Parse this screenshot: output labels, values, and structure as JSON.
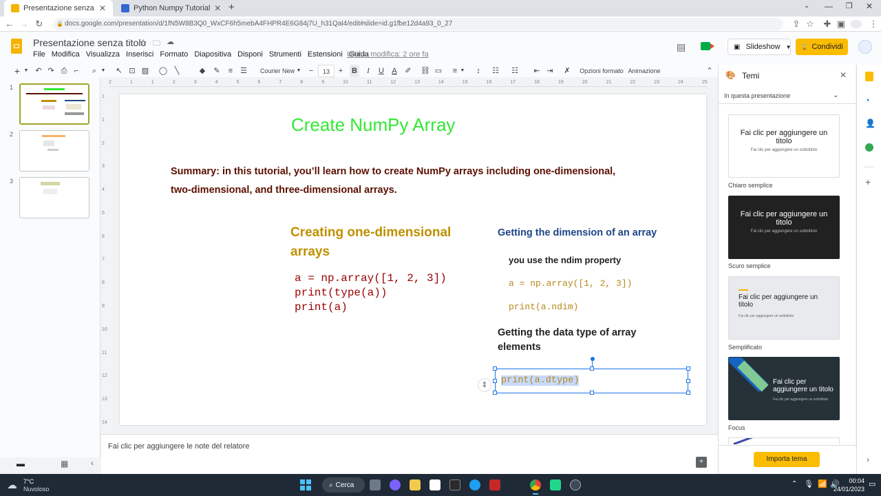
{
  "browser": {
    "tabs": [
      {
        "title": "Presentazione senza titolo - Pres",
        "favicon_color": "#f4b400",
        "active": true
      },
      {
        "title": "Python Numpy Tutorial",
        "favicon_color": "#3367d6",
        "active": false
      }
    ],
    "new_tab": "+",
    "url": "docs.google.com/presentation/d/1fN5W8B3Q0_WxCF6h5mebA4FHPR4E6G84j7U_h31Qal4/edit#slide=id.g1fbe12d4a93_0_27"
  },
  "docs": {
    "title": "Presentazione senza titolo",
    "menu": [
      "File",
      "Modifica",
      "Visualizza",
      "Inserisci",
      "Formato",
      "Diapositiva",
      "Disponi",
      "Strumenti",
      "Estensioni",
      "Guida"
    ],
    "last_edit": "Ultima modifica: 2 ore fa",
    "slideshow_label": "Slideshow",
    "share_label": "Condividi",
    "brand_color": "#f4b400"
  },
  "toolbar": {
    "font": "Courier New",
    "font_size": "13",
    "minus": "−",
    "plus": "+",
    "bold": "B",
    "italic": "I",
    "underline": "U",
    "text_color": "A",
    "format_options": "Opzioni formato",
    "animation": "Animazione"
  },
  "filmstrip": {
    "slides": [
      {
        "num": "1"
      },
      {
        "num": "2"
      },
      {
        "num": "3"
      }
    ]
  },
  "ruler": {
    "top": [
      "2",
      "1",
      "1",
      "2",
      "3",
      "4",
      "5",
      "6",
      "7",
      "8",
      "9",
      "10",
      "11",
      "12",
      "13",
      "14",
      "15",
      "16",
      "17",
      "18",
      "19",
      "20",
      "21",
      "22",
      "23",
      "24",
      "25"
    ],
    "left": [
      "1",
      "1",
      "2",
      "3",
      "4",
      "5",
      "6",
      "7",
      "8",
      "9",
      "10",
      "11",
      "12",
      "13",
      "14"
    ]
  },
  "slide": {
    "title": "Create NumPy Array",
    "summary_line1": "Summary: in this tutorial, you’ll learn how to create NumPy arrays including one-dimensional,",
    "summary_line2": "two-dimensional, and three-dimensional arrays.",
    "left_heading_line1": "Creating one-dimensional",
    "left_heading_line2": "arrays",
    "left_code": [
      "a = np.array([1, 2, 3])",
      "print(type(a))",
      "print(a)"
    ],
    "right_heading": "Getting the dimension of an array",
    "ndim_text": "you use the ndim property",
    "ndim_code1": "a = np.array([1, 2, 3])",
    "ndim_code2": "print(a.ndim)",
    "dtype_heading_line1": "Getting the data type of array",
    "dtype_heading_line2": "elements",
    "dtype_code": "print(a.dtype)",
    "colors": {
      "title": "#33e833",
      "summary": "#5b0f00",
      "left_heading": "#bf9000",
      "code_dark": "#990000",
      "right_heading": "#1c4587",
      "code_gold": "#b8891a",
      "selection": "#1a73e8"
    }
  },
  "notes": {
    "placeholder": "Fai clic per aggiungere le note del relatore"
  },
  "themes": {
    "title": "Temi",
    "section": "In questa presentazione",
    "items": [
      {
        "name": "Chiaro semplice",
        "title": "Fai clic per aggiungere un titolo",
        "subtitle": "Fai clic per aggiungere un sottotitolo",
        "bg": "#ffffff",
        "fg": "#202124"
      },
      {
        "name": "Scuro semplice",
        "title": "Fai clic per aggiungere un titolo",
        "subtitle": "Fai clic per aggiungere un sottotitolo",
        "bg": "#212121",
        "fg": "#ffffff"
      },
      {
        "name": "Semplificato",
        "title": "Fai clic per aggiungere un titolo",
        "subtitle": "Fai clic per aggiungere un sottotitolo",
        "bg": "#e8eaed",
        "fg": "#202124"
      },
      {
        "name": "Focus",
        "title": "Fai clic per aggiungere un titolo",
        "subtitle": "Fai clic per aggiungere un sottotitolo",
        "bg": "#263238",
        "fg": "#ffffff"
      }
    ],
    "import_button": "Importa tema",
    "import_color": "#fbbc04"
  },
  "taskbar": {
    "weather_temp": "7°C",
    "weather_text": "Nuvoloso",
    "search_label": "Cerca",
    "time": "00:04",
    "date": "24/01/2023"
  }
}
